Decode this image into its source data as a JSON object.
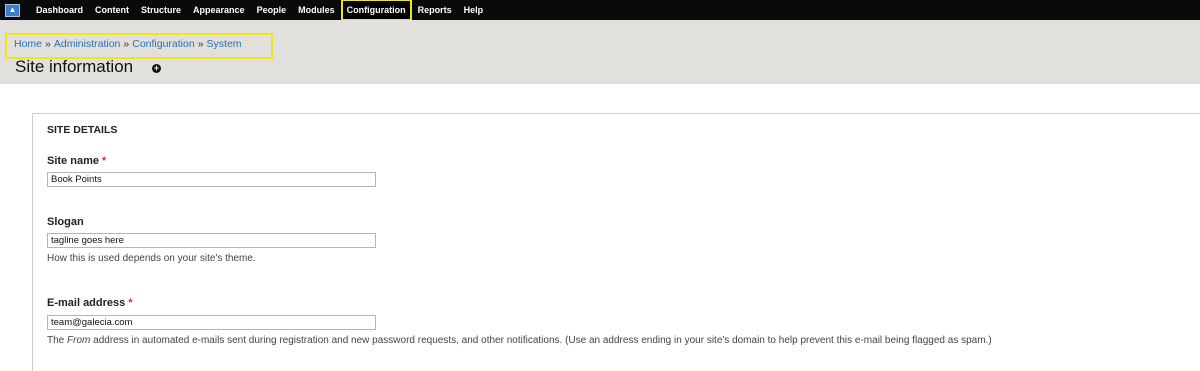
{
  "toolbar": {
    "logo_icon": "drupal-logo-icon",
    "items": [
      {
        "label": "Dashboard"
      },
      {
        "label": "Content"
      },
      {
        "label": "Structure"
      },
      {
        "label": "Appearance"
      },
      {
        "label": "People"
      },
      {
        "label": "Modules"
      },
      {
        "label": "Configuration",
        "active": true
      },
      {
        "label": "Reports"
      },
      {
        "label": "Help"
      }
    ],
    "highlight_color": "#f0e51a"
  },
  "breadcrumb": {
    "items": [
      "Home",
      "Administration",
      "Configuration",
      "System"
    ],
    "separator": "»"
  },
  "page": {
    "title": "Site information",
    "shortcut_icon": "add-shortcut-icon",
    "shortcut_glyph": "+"
  },
  "site_details": {
    "legend": "SITE DETAILS",
    "site_name": {
      "label": "Site name",
      "required_mark": "*",
      "value": "Book Points"
    },
    "slogan": {
      "label": "Slogan",
      "value": "tagline goes here",
      "description": "How this is used depends on your site's theme."
    },
    "email": {
      "label": "E-mail address",
      "required_mark": "*",
      "value": "team@galecia.com",
      "description_prefix": "The ",
      "description_em": "From",
      "description_suffix": " address in automated e-mails sent during registration and new password requests, and other notifications. (Use an address ending in your site's domain to help prevent this e-mail being flagged as spam.)"
    }
  }
}
